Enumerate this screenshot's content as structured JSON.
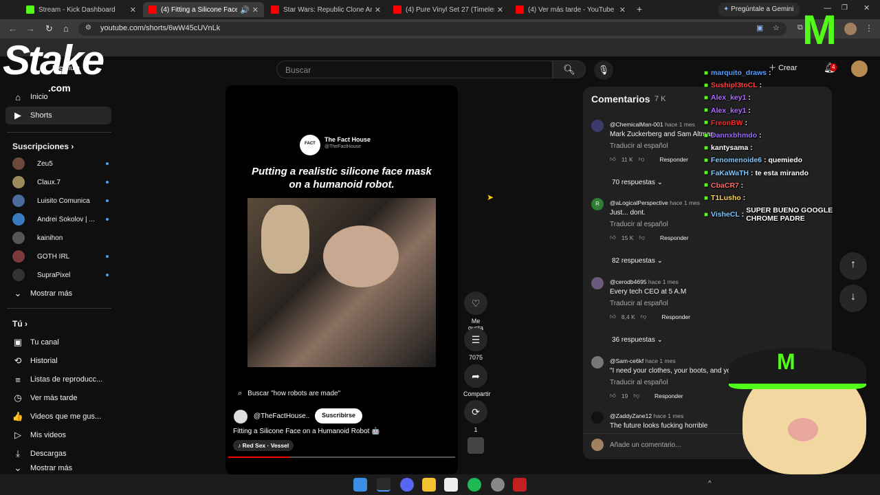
{
  "browser": {
    "tabs": [
      {
        "title": "Stream - Kick Dashboard",
        "color": "#53fc18",
        "active": false
      },
      {
        "title": "(4) Fitting a Silicone Face on",
        "color": "#ff0000",
        "active": true
      },
      {
        "title": "Star Wars: Republic Clone Army",
        "color": "#ff0000",
        "active": false
      },
      {
        "title": "(4) Pure Vinyl Set 27 (Timeless",
        "color": "#ff0000",
        "active": false
      },
      {
        "title": "(4) Ver más tarde - YouTube",
        "color": "#ff0000",
        "active": false
      }
    ],
    "gemini_label": "Pregúntale a Gemini",
    "url": "youtube.com/shorts/6wW45cUVnLk"
  },
  "overlay": {
    "stake_logo": "Stake",
    "stake_com": ".com",
    "stake_premium": "Premium"
  },
  "header": {
    "search_placeholder": "Buscar",
    "create_label": "Crear",
    "notif_count": "4"
  },
  "sidebar": {
    "main": [
      {
        "label": "Inicio",
        "icon": "home-icon"
      },
      {
        "label": "Shorts",
        "icon": "shorts-icon"
      }
    ],
    "subs_title": "Suscripciones",
    "subs": [
      {
        "label": "Zeu5",
        "color": "#6b4a3a"
      },
      {
        "label": "Claux.7",
        "color": "#9b8a5a"
      },
      {
        "label": "Luisito Comunica",
        "color": "#4a6b9b"
      },
      {
        "label": "Andrei Sokolov | ...",
        "color": "#3a7bbf"
      },
      {
        "label": "kainihon",
        "color": "#555555"
      },
      {
        "label": "GOTH IRL",
        "color": "#7a3a3a"
      },
      {
        "label": "SupraPixel",
        "color": "#333333"
      }
    ],
    "show_more": "Mostrar más",
    "you_title": "Tú",
    "you": [
      {
        "label": "Tu canal",
        "icon": "channel-icon"
      },
      {
        "label": "Historial",
        "icon": "history-icon"
      },
      {
        "label": "Listas de reproducc...",
        "icon": "playlist-icon"
      },
      {
        "label": "Ver más tarde",
        "icon": "clock-icon"
      },
      {
        "label": "Videos que me gus...",
        "icon": "like-icon"
      },
      {
        "label": "Mis videos",
        "icon": "video-icon"
      },
      {
        "label": "Descargas",
        "icon": "download-icon"
      }
    ],
    "show_more_2": "Mostrar más"
  },
  "short": {
    "source_name": "The Fact House",
    "source_handle": "@TheFactHouse",
    "caption": "Putting a realistic silicone face mask on a humanoid robot.",
    "search_query": "Buscar \"how robots are made\"",
    "channel": "@TheFactHouse..",
    "subscribe": "Suscribirse",
    "title": "Fitting a Silicone Face on a Humanoid Robot 🤖",
    "sound": "♪ Red Sex · Vessel",
    "progress": 0.27
  },
  "actions": {
    "like": "Me gusta",
    "comments_count": "7075",
    "share": "Compartir",
    "remix_count": "1"
  },
  "comments": {
    "title": "Comentarios",
    "count": "7 K",
    "items": [
      {
        "user": "@ChemicalMan-001",
        "ago": "hace 1 mes",
        "text": "Mark Zuckerberg and Sam Altman...",
        "translate": "Traducir al español",
        "likes": "11 K",
        "reply": "Responder",
        "replies": "70 respuestas",
        "avatar": "#3a3a6b"
      },
      {
        "user": "@aLogicalPerspective",
        "ago": "hace 1 mes",
        "text": "Just... dont.",
        "translate": "Traducir al español",
        "likes": "15 K",
        "reply": "Responder",
        "replies": "82 respuestas",
        "avatar": "#2e7d32"
      },
      {
        "user": "@cerodb4695",
        "ago": "hace 1 mes",
        "text": "Every tech CEO at 5 A.M",
        "translate": "Traducir al español",
        "likes": "8,4 K",
        "reply": "Responder",
        "replies": "36 respuestas",
        "avatar": "#6b5a7b"
      },
      {
        "user": "@Sam-ce6kf",
        "ago": "hace 1 mes",
        "text": "\"I need your clothes, your boots, and yo",
        "translate": "Traducir al español",
        "likes": "19",
        "reply": "Responder",
        "replies": "",
        "avatar": "#777777"
      },
      {
        "user": "@ZaddyZane12",
        "ago": "hace 1 mes",
        "text": "The future looks fucking horrible",
        "translate": "",
        "likes": "",
        "reply": "",
        "replies": "",
        "avatar": "#111111"
      }
    ],
    "add_placeholder": "Añade un comentario..."
  },
  "chat": [
    {
      "user": "marquito_draws",
      "color": "#5aa0ff",
      "msg": ""
    },
    {
      "user": "Sushipl3toCL",
      "color": "#ff4040",
      "msg": ""
    },
    {
      "user": "Alex_key1",
      "color": "#b070ff",
      "msg": ""
    },
    {
      "user": "Alex_key1",
      "color": "#b070ff",
      "msg": ""
    },
    {
      "user": "FreonBW",
      "color": "#ff2a2a",
      "msg": ""
    },
    {
      "user": "Dannxbhmdo",
      "color": "#9a6bff",
      "msg": ""
    },
    {
      "user": "kantysama",
      "color": "#ffffff",
      "msg": ""
    },
    {
      "user": "Fenomenoide6",
      "color": "#7ec8ff",
      "msg": "quemiedo"
    },
    {
      "user": "FaKaWaTH",
      "color": "#7ec8ff",
      "msg": "te esta mirando"
    },
    {
      "user": "CbaCR7",
      "color": "#ff6a6a",
      "msg": ""
    },
    {
      "user": "T1Lusho",
      "color": "#ffd24a",
      "msg": ""
    },
    {
      "user": "VisheCL",
      "color": "#7ec8ff",
      "msg": "SUPER BUENO GOOGLE CHROME PADRE"
    }
  ],
  "colors": {
    "accent": "#ff0000",
    "kick": "#53fc18",
    "link": "#3ea6ff"
  }
}
